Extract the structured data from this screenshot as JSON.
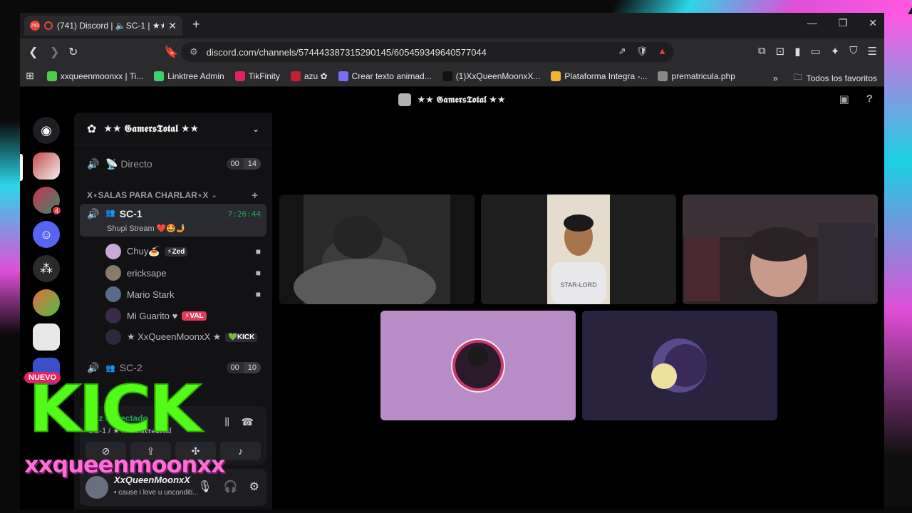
{
  "browser": {
    "tab": {
      "badge": "741",
      "title": "(741) Discord | 🔈SC-1 | ★★ ·"
    },
    "url": "discord.com/channels/574443387315290145/605459349640577044",
    "bookmarks": [
      {
        "label": "xxqueenmoonxx | Ti...",
        "color": "#4ad04a"
      },
      {
        "label": "Linktree Admin",
        "color": "#3bd46a"
      },
      {
        "label": "TikFinity",
        "color": "#e0245e"
      },
      {
        "label": "azu ✿",
        "color": "#c02030"
      },
      {
        "label": "Crear texto animad...",
        "color": "#7b6cff"
      },
      {
        "label": "(1)XxQueenMoonxX...",
        "color": "#111111"
      },
      {
        "label": "Plataforma Integra -...",
        "color": "#f2b233"
      },
      {
        "label": "prematricula.php",
        "color": "#888888"
      }
    ],
    "more_bookmarks": "»",
    "all_favorites": "Todos los favoritos"
  },
  "discord": {
    "title": "★★ 𝕲𝖆𝖒𝖊𝖗𝖘𝕿𝖔𝖙𝖆𝖑 ★★",
    "server_name": "★★ 𝕲𝖆𝖒𝖊𝖗𝖘𝕿𝖔𝖙𝖆𝖑 ★★",
    "channel_directo": {
      "label": "📡 Directo",
      "count_a": "00",
      "count_b": "14"
    },
    "category": "X⋆SALAS PARA CHARLAR⋆X",
    "active_channel": {
      "label": "SC-1",
      "timer": "7:26:44",
      "status": "Shupi Stream ❤️🤩🤳"
    },
    "voice_users": [
      {
        "name": "Chuy🍝",
        "tag": "⚡Zed",
        "tag_color": "#2b2d31",
        "camera": true,
        "avatar": "#c7a8d8"
      },
      {
        "name": "ericksape",
        "tag": "",
        "tag_color": "",
        "camera": true,
        "avatar": "#8a7a6a"
      },
      {
        "name": "Mario Stark",
        "tag": "",
        "tag_color": "",
        "camera": true,
        "avatar": "#5a6a8a"
      },
      {
        "name": "Mi Guarito ♥",
        "tag": "⚡VAL",
        "tag_color": "#e03c5c",
        "camera": false,
        "avatar": "#3a2a4a"
      },
      {
        "name": "★ XxQueenMoonxX ★",
        "tag": "💚KICK",
        "tag_color": "#2b2d31",
        "camera": false,
        "avatar": "#2a2a3a"
      }
    ],
    "channel_sc2": {
      "label": "SC-2",
      "count_a": "00",
      "count_b": "10"
    },
    "voice_panel": {
      "status": "Voz conectado",
      "sub": "SC-1 / ★★ 𝕲𝖆𝖒𝖊𝖗𝖘𝕿𝖔𝖙𝖆𝖑"
    },
    "user_panel": {
      "name": "XxQueenMoonxX",
      "status": "• cause i love u unconditi..."
    },
    "guild_badges": {
      "g2": "4"
    }
  },
  "overlay": {
    "nuevo": "NUEVO",
    "kick": "KICK",
    "handle": "xxqueenmoonxx"
  }
}
